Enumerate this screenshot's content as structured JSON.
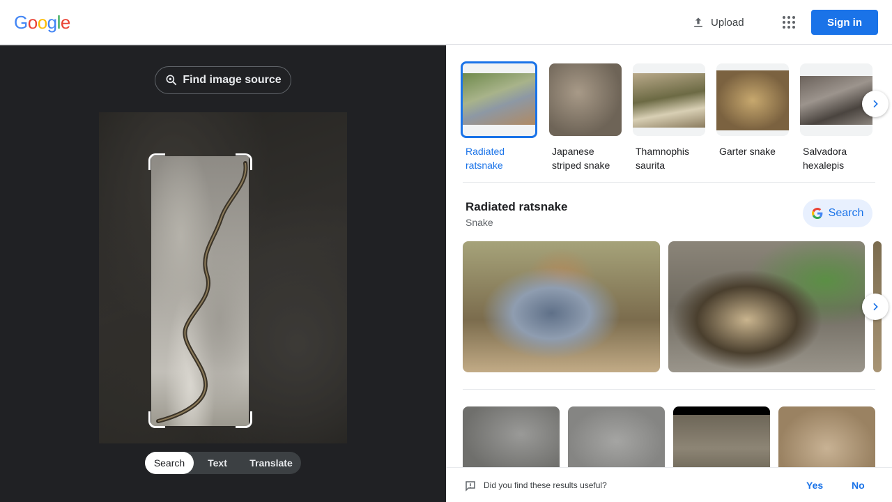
{
  "header": {
    "logo_letters": [
      "G",
      "o",
      "o",
      "g",
      "l",
      "e"
    ],
    "logo_colors": [
      "#4285F4",
      "#EA4335",
      "#FBBC05",
      "#4285F4",
      "#34A853",
      "#EA4335"
    ],
    "upload_label": "Upload",
    "signin_label": "Sign in"
  },
  "left_pane": {
    "find_source_label": "Find image source",
    "modes": [
      "Search",
      "Text",
      "Translate"
    ],
    "selected_mode": "Search"
  },
  "related_chips": [
    {
      "label": "Radiated ratsnake",
      "selected": true
    },
    {
      "label": "Japanese striped snake",
      "selected": false
    },
    {
      "label": "Thamnophis saurita",
      "selected": false
    },
    {
      "label": "Garter snake",
      "selected": false
    },
    {
      "label": "Salvadora hexalepis",
      "selected": false
    }
  ],
  "knowledge_panel": {
    "title": "Radiated ratsnake",
    "subtitle": "Snake",
    "search_label": "Search"
  },
  "feedback": {
    "question": "Did you find these results useful?",
    "yes_label": "Yes",
    "no_label": "No"
  },
  "colors": {
    "accent": "#1a73e8",
    "dark_pane": "#202124"
  }
}
